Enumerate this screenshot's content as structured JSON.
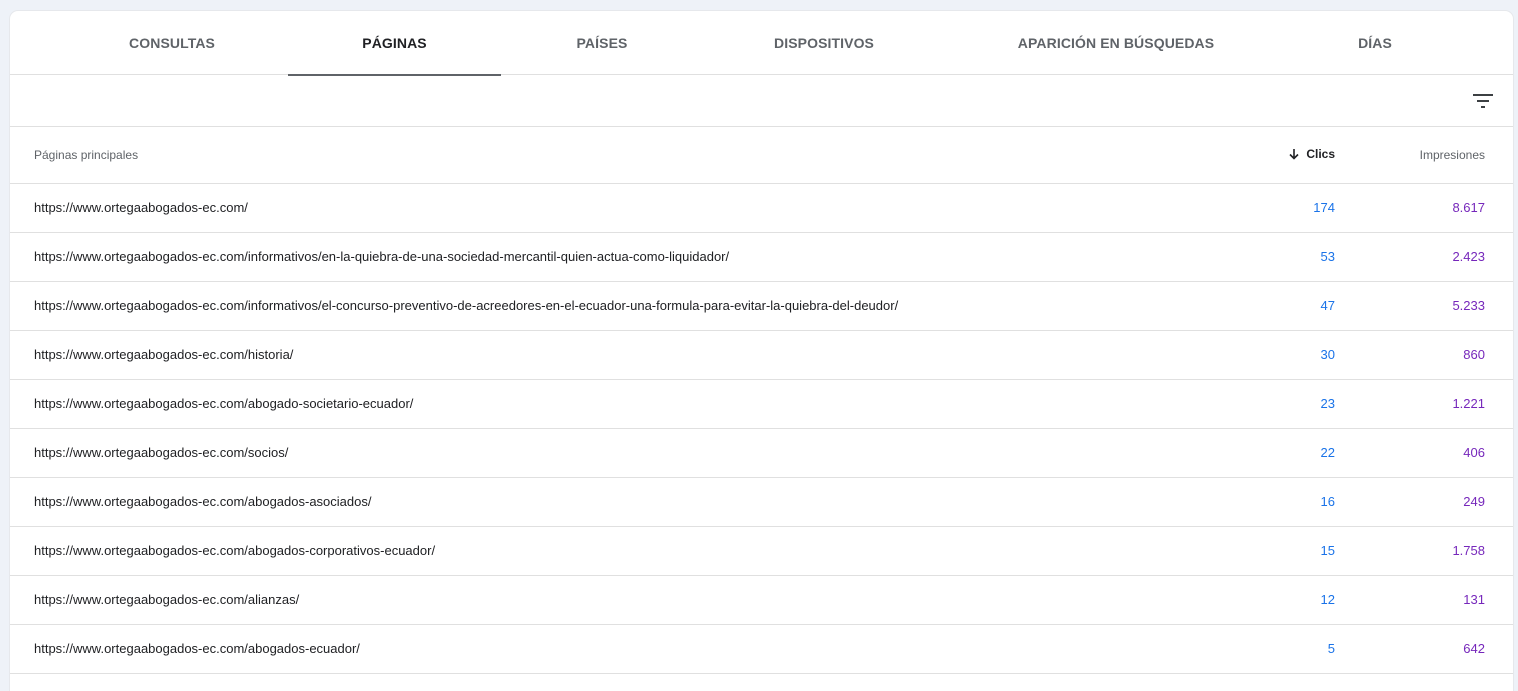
{
  "tabs": [
    {
      "label": "CONSULTAS",
      "active": false
    },
    {
      "label": "PÁGINAS",
      "active": true
    },
    {
      "label": "PAÍSES",
      "active": false
    },
    {
      "label": "DISPOSITIVOS",
      "active": false
    },
    {
      "label": "APARICIÓN EN BÚSQUEDAS",
      "active": false
    },
    {
      "label": "DÍAS",
      "active": false
    }
  ],
  "toolbar": {
    "filter_icon": "filter-list-icon"
  },
  "table": {
    "headers": {
      "page": "Páginas principales",
      "clicks": "Clics",
      "impressions": "Impresiones",
      "sort_icon": "arrow-down-icon"
    },
    "rows": [
      {
        "url": "https://www.ortegaabogados-ec.com/",
        "clicks": "174",
        "impressions": "8.617"
      },
      {
        "url": "https://www.ortegaabogados-ec.com/informativos/en-la-quiebra-de-una-sociedad-mercantil-quien-actua-como-liquidador/",
        "clicks": "53",
        "impressions": "2.423"
      },
      {
        "url": "https://www.ortegaabogados-ec.com/informativos/el-concurso-preventivo-de-acreedores-en-el-ecuador-una-formula-para-evitar-la-quiebra-del-deudor/",
        "clicks": "47",
        "impressions": "5.233"
      },
      {
        "url": "https://www.ortegaabogados-ec.com/historia/",
        "clicks": "30",
        "impressions": "860"
      },
      {
        "url": "https://www.ortegaabogados-ec.com/abogado-societario-ecuador/",
        "clicks": "23",
        "impressions": "1.221"
      },
      {
        "url": "https://www.ortegaabogados-ec.com/socios/",
        "clicks": "22",
        "impressions": "406"
      },
      {
        "url": "https://www.ortegaabogados-ec.com/abogados-asociados/",
        "clicks": "16",
        "impressions": "249"
      },
      {
        "url": "https://www.ortegaabogados-ec.com/abogados-corporativos-ecuador/",
        "clicks": "15",
        "impressions": "1.758"
      },
      {
        "url": "https://www.ortegaabogados-ec.com/alianzas/",
        "clicks": "12",
        "impressions": "131"
      },
      {
        "url": "https://www.ortegaabogados-ec.com/abogados-ecuador/",
        "clicks": "5",
        "impressions": "642"
      }
    ]
  },
  "colors": {
    "clicks": "#1a73e8",
    "impressions": "#7627bb",
    "active_tab_indicator": "#5f6368"
  }
}
